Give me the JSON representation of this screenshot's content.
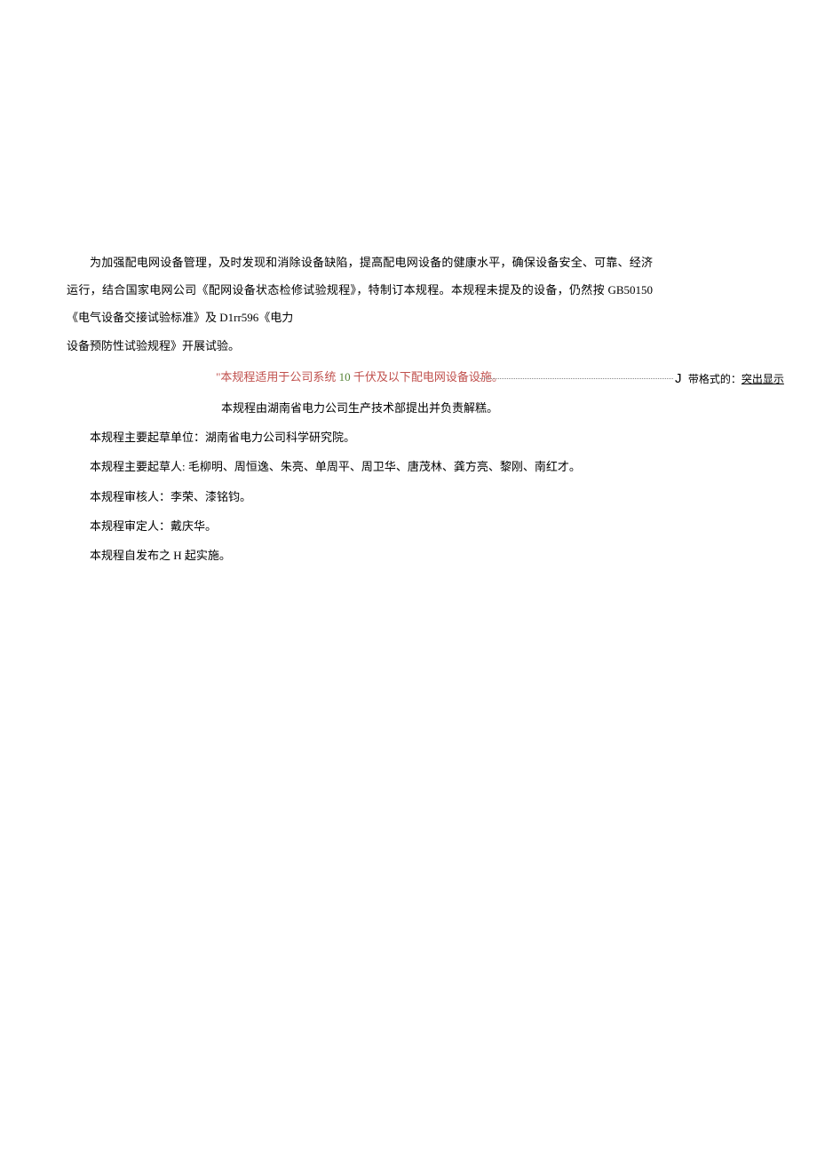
{
  "paragraphs": {
    "p1_part1": "为加强配电网设备管理，及时发现和消除设备缺陷，提高配电网设备的健康水平，确保设备安全、可靠、经济运行，结合国家电网公司《配网设备状态检修试验规程》，特制订本规程。本规程未提及的设备，仍然按 GB50150《电气设备交接试验标准》及 D1rr596《电力",
    "p1_part2": "设备预防性试验规程》开展试验。"
  },
  "highlighted": {
    "prefix": "\"本规程适用于公司系统 ",
    "number": "10",
    "suffix": " 千伏及以下配电网设备设施。"
  },
  "centered_line": "本规程由湖南省电力公司生产技术部提出并负责解糕。",
  "items": [
    "本规程主要起草单位：湖南省电力公司科学研究院。",
    "本规程主要起草人: 毛柳明、周恒逸、朱亮、单周平、周卫华、唐茂林、龚方亮、黎刚、南红才。",
    "本规程审核人：李荣、漆铭钧。",
    "本规程审定人：戴庆华。",
    "本规程自发布之 H 起实施。"
  ],
  "annotation": {
    "marker": "J",
    "label": "带格式的：",
    "value": "突出显示"
  }
}
